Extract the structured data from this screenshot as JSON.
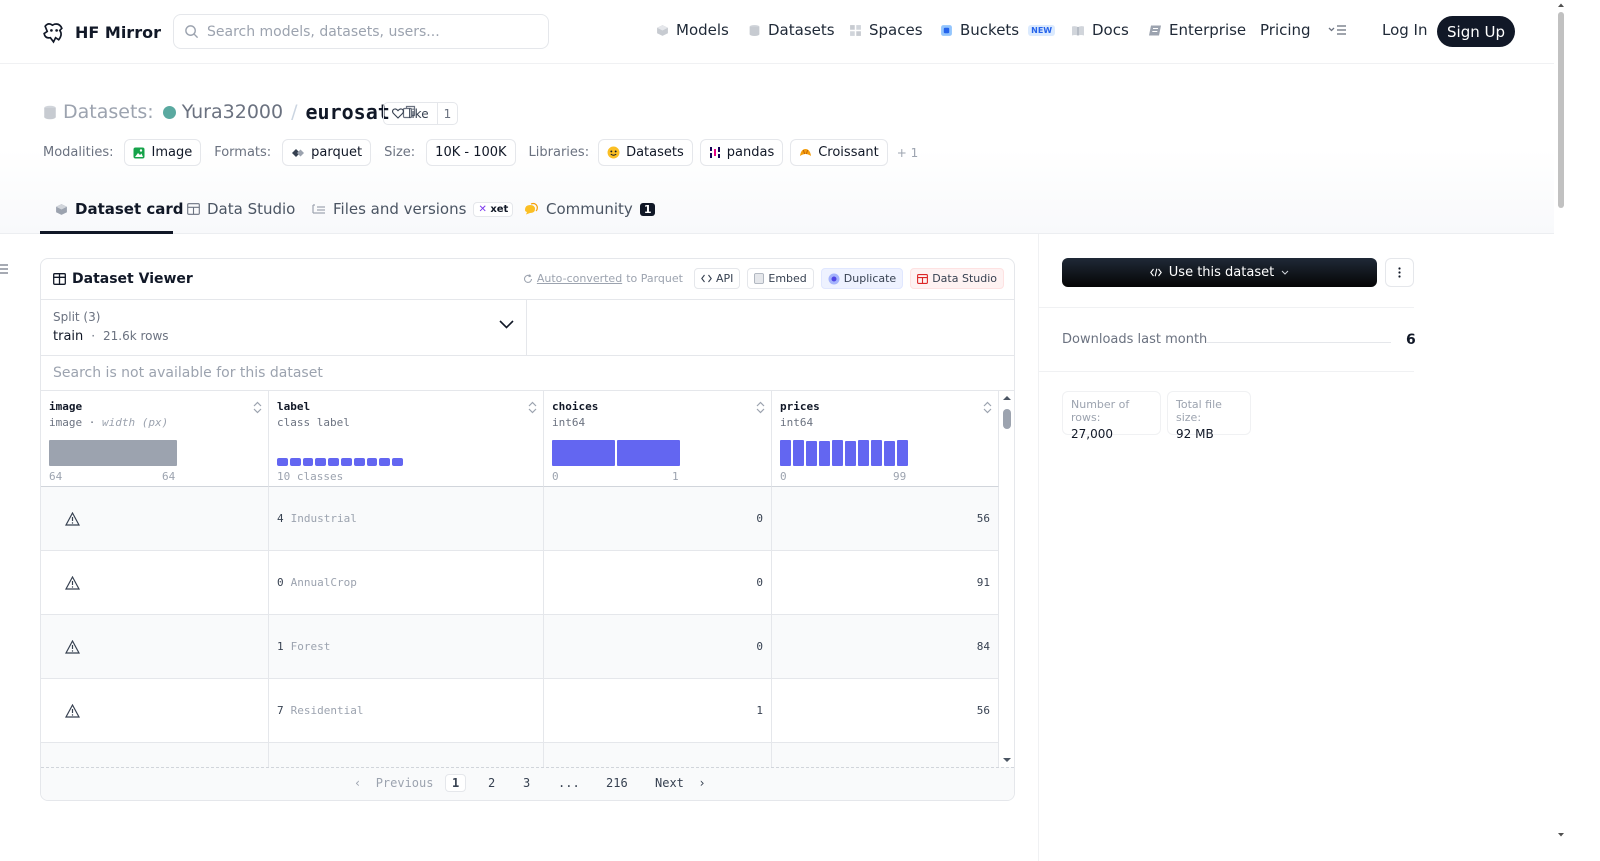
{
  "header": {
    "logo_text": "HF Mirror",
    "search_placeholder": "Search models, datasets, users...",
    "nav": [
      {
        "label": "Models",
        "icon": "cube-icon"
      },
      {
        "label": "Datasets",
        "icon": "database-icon"
      },
      {
        "label": "Spaces",
        "icon": "grid-icon"
      },
      {
        "label": "Buckets",
        "icon": "bucket-icon",
        "badge": "NEW"
      },
      {
        "label": "Docs",
        "icon": "book-icon"
      },
      {
        "label": "Enterprise",
        "icon": "enterprise-icon"
      },
      {
        "label": "Pricing"
      }
    ],
    "login": "Log In",
    "signup": "Sign Up"
  },
  "repo": {
    "type_label": "Datasets:",
    "owner": "Yura32000",
    "name": "eurosat",
    "like_label": "like",
    "like_count": "1"
  },
  "meta": {
    "modalities_label": "Modalities:",
    "modality": "Image",
    "formats_label": "Formats:",
    "format": "parquet",
    "size_label": "Size:",
    "size": "10K - 100K",
    "libraries_label": "Libraries:",
    "libraries": [
      "Datasets",
      "pandas",
      "Croissant"
    ],
    "more": "+ 1"
  },
  "tabs": {
    "dataset_card": "Dataset card",
    "data_studio": "Data Studio",
    "files": "Files and versions",
    "xet": "xet",
    "community": "Community",
    "community_count": "1"
  },
  "viewer": {
    "title": "Dataset Viewer",
    "auto_converted": "Auto-converted",
    "to_parquet": "to Parquet",
    "api": "API",
    "embed": "Embed",
    "duplicate": "Duplicate",
    "data_studio": "Data Studio",
    "split_title": "Split (3)",
    "split_value": "train",
    "split_rows": "21.6k rows",
    "search_na": "Search is not available for this dataset",
    "columns": [
      {
        "name": "image",
        "type": "image",
        "type_extra": "width (px)",
        "min": "64",
        "max": "64"
      },
      {
        "name": "label",
        "type": "class label",
        "summary": "10 classes"
      },
      {
        "name": "choices",
        "type": "int64",
        "min": "0",
        "max": "1"
      },
      {
        "name": "prices",
        "type": "int64",
        "min": "0",
        "max": "99"
      }
    ],
    "histograms": {
      "image": [
        1.0
      ],
      "label": [
        1,
        1,
        1,
        1,
        1,
        1,
        1,
        1,
        1,
        1
      ],
      "choices": [
        1.0,
        1.0
      ],
      "prices": [
        1.0,
        1.0,
        0.96,
        0.98,
        1.0,
        0.97,
        0.99,
        1.0,
        0.98,
        1.0
      ]
    },
    "rows": [
      {
        "label_idx": "4",
        "label_name": "Industrial",
        "choices": "0",
        "prices": "56"
      },
      {
        "label_idx": "0",
        "label_name": "AnnualCrop",
        "choices": "0",
        "prices": "91"
      },
      {
        "label_idx": "1",
        "label_name": "Forest",
        "choices": "0",
        "prices": "84"
      },
      {
        "label_idx": "7",
        "label_name": "Residential",
        "choices": "1",
        "prices": "56"
      }
    ],
    "pager": {
      "previous": "Previous",
      "pages": [
        "1",
        "2",
        "3",
        "...",
        "216"
      ],
      "current": "1",
      "next": "Next"
    }
  },
  "sidebar": {
    "use_button": "Use this dataset",
    "downloads_label": "Downloads last month",
    "downloads_value": "6",
    "rows_label": "Number of rows:",
    "rows_value": "27,000",
    "size_label": "Total file size:",
    "size_value": "92 MB"
  },
  "colors": {
    "accent": "#111827",
    "histogram": "#6366f1",
    "image_histogram": "#9ca3af"
  }
}
